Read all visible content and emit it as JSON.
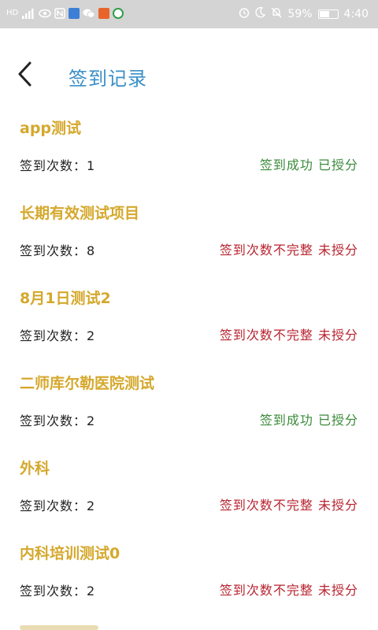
{
  "status_bar": {
    "network_left": "HD",
    "signal_label": "4G",
    "battery_percent": "59%",
    "battery_level": 0.59,
    "time": "4:40"
  },
  "header": {
    "title": "签到记录"
  },
  "records": [
    {
      "title": "app测试",
      "count_label": "签到次数：",
      "count": "1",
      "status": "签到成功 已授分",
      "status_type": "ok"
    },
    {
      "title": "长期有效测试项目",
      "count_label": "签到次数：",
      "count": "8",
      "status": "签到次数不完整 未授分",
      "status_type": "fail"
    },
    {
      "title": "8月1日测试2",
      "count_label": "签到次数：",
      "count": "2",
      "status": "签到次数不完整 未授分",
      "status_type": "fail"
    },
    {
      "title": "二师库尔勒医院测试",
      "count_label": "签到次数：",
      "count": "2",
      "status": "签到成功 已授分",
      "status_type": "ok"
    },
    {
      "title": "外科",
      "count_label": "签到次数：",
      "count": "2",
      "status": "签到次数不完整 未授分",
      "status_type": "fail"
    },
    {
      "title": "内科培训测试0",
      "count_label": "签到次数：",
      "count": "2",
      "status": "签到次数不完整 未授分",
      "status_type": "fail"
    }
  ],
  "colors": {
    "title_blue": "#3a8fc8",
    "record_title_gold": "#d5a82c",
    "status_ok_green": "#3a8a3a",
    "status_fail_red": "#b8232f"
  }
}
